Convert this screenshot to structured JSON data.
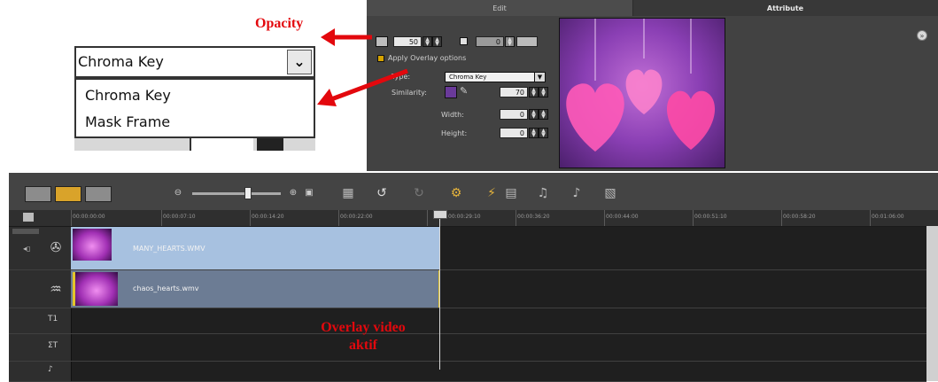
{
  "annotations": {
    "opacity": "Opacity",
    "overlay_line1": "Overlay video",
    "overlay_line2": "aktif"
  },
  "inset": {
    "select_value": "Chroma Key",
    "options": [
      "Chroma Key",
      "Mask Frame"
    ]
  },
  "attribute_panel": {
    "tabs": [
      "Edit",
      "Attribute"
    ],
    "opacity_value": "50",
    "border_value": "0",
    "apply_overlay_label": "Apply Overlay options",
    "type_label": "Type:",
    "type_value": "Chroma Key",
    "similarity_label": "Similarity:",
    "similarity_value": "70",
    "width_label": "Width:",
    "width_value": "0",
    "height_label": "Height:",
    "height_value": "0",
    "similarity_color": "#6a3a9a"
  },
  "timeline": {
    "ruler_ticks": [
      "00:00:00:00",
      "00:00:07:10",
      "00:00:14:20",
      "00:00:22:00",
      "00:00:29:10",
      "00:00:36:20",
      "00:00:44:00",
      "00:00:51:10",
      "00:00:58:20",
      "00:01:06:00"
    ],
    "tracks": [
      {
        "icon": "video-track-icon",
        "clip_name": "MANY_HEARTS.WMV"
      },
      {
        "icon": "overlay-track-icon",
        "clip_name": "chaos_hearts.wmv"
      },
      {
        "icon": "title-track-icon",
        "clip_name": ""
      },
      {
        "icon": "voice-track-icon",
        "clip_name": ""
      }
    ],
    "track_labels": [
      "T1",
      "ΣT"
    ]
  },
  "colors": {
    "annotation_red": "#e3080d",
    "clip_video": "#a7c1e0",
    "clip_overlay": "#6c7c94",
    "clip_highlight": "#e4c52a"
  }
}
